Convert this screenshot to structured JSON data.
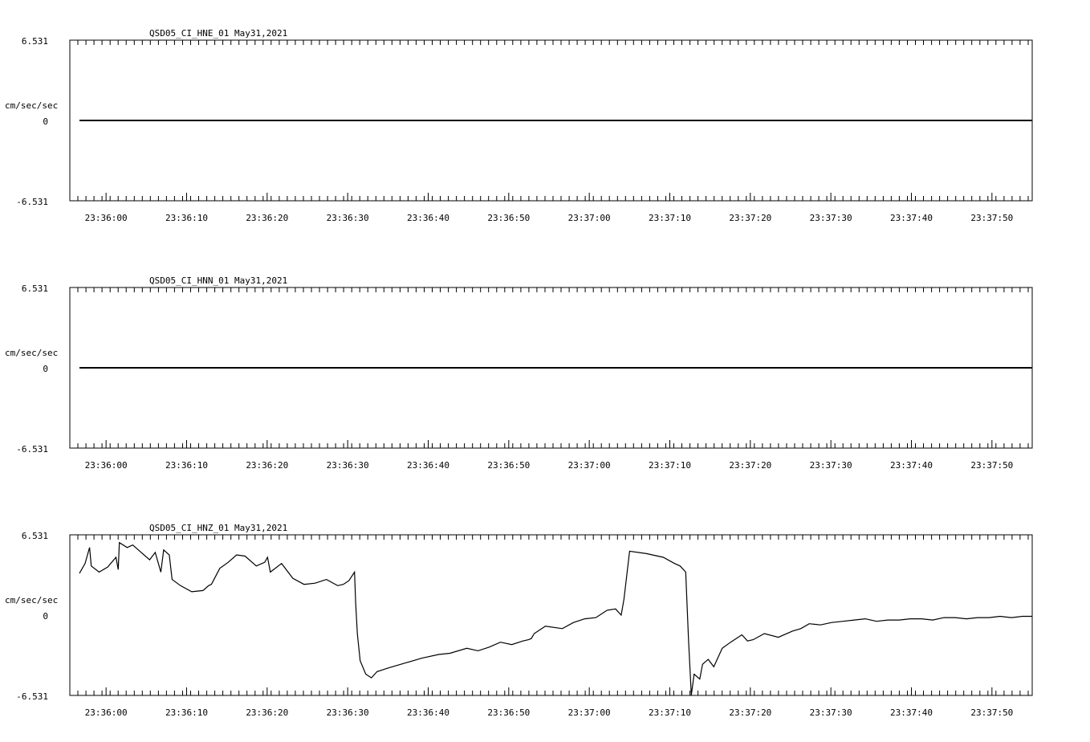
{
  "chart_data": [
    {
      "type": "line",
      "title": "QSD05_CI_HNE_01  May31,2021",
      "ylabel": "cm/sec/sec",
      "ylim": [
        -6.531,
        6.531
      ],
      "yticks": [
        "6.531",
        "0",
        "-6.531"
      ],
      "x_start": "23:35:55.5",
      "x_end": "23:37:55",
      "xticks": [
        "23:36:00",
        "23:36:10",
        "23:36:20",
        "23:36:30",
        "23:36:40",
        "23:36:50",
        "23:37:00",
        "23:37:10",
        "23:37:20",
        "23:37:30",
        "23:37:40",
        "23:37:50"
      ],
      "series": [
        {
          "points": [
            [
              0.0,
              0.0
            ],
            [
              118.5,
              0.0
            ]
          ]
        }
      ]
    },
    {
      "type": "line",
      "title": "QSD05_CI_HNN_01  May31,2021",
      "ylabel": "cm/sec/sec",
      "ylim": [
        -6.531,
        6.531
      ],
      "yticks": [
        "6.531",
        "0",
        "-6.531"
      ],
      "x_start": "23:35:55.5",
      "x_end": "23:37:55",
      "xticks": [
        "23:36:00",
        "23:36:10",
        "23:36:20",
        "23:36:30",
        "23:36:40",
        "23:36:50",
        "23:37:00",
        "23:37:10",
        "23:37:20",
        "23:37:30",
        "23:37:40",
        "23:37:50"
      ],
      "series": [
        {
          "points": [
            [
              0.0,
              0.0
            ],
            [
              118.5,
              0.0
            ]
          ]
        }
      ]
    },
    {
      "type": "line",
      "title": "QSD05_CI_HNZ_01  May31,2021",
      "ylabel": "cm/sec/sec",
      "ylim": [
        -6.531,
        6.531
      ],
      "yticks": [
        "6.531",
        "0",
        "-6.531"
      ],
      "x_start": "23:35:55.5",
      "x_end": "23:37:55",
      "xticks": [
        "23:36:00",
        "23:36:10",
        "23:36:20",
        "23:36:30",
        "23:36:40",
        "23:36:50",
        "23:37:00",
        "23:37:10",
        "23:37:20",
        "23:37:30",
        "23:37:40",
        "23:37:50"
      ],
      "series": [
        {
          "points": [
            [
              0.0,
              3.4
            ],
            [
              1.0,
              4.2
            ],
            [
              1.8,
              5.5
            ],
            [
              2.1,
              4.0
            ],
            [
              3.5,
              3.5
            ],
            [
              5.0,
              3.9
            ],
            [
              6.5,
              4.7
            ],
            [
              6.9,
              3.7
            ],
            [
              7.1,
              5.9
            ],
            [
              8.5,
              5.5
            ],
            [
              9.5,
              5.7
            ],
            [
              11.0,
              5.1
            ],
            [
              12.5,
              4.5
            ],
            [
              13.5,
              5.1
            ],
            [
              14.5,
              3.5
            ],
            [
              15.0,
              5.3
            ],
            [
              16.0,
              4.9
            ],
            [
              16.5,
              2.9
            ],
            [
              18.0,
              2.4
            ],
            [
              20.0,
              1.9
            ],
            [
              22.0,
              2.0
            ],
            [
              23.0,
              2.4
            ],
            [
              23.5,
              2.5
            ],
            [
              25.0,
              3.8
            ],
            [
              26.5,
              4.3
            ],
            [
              28.0,
              4.9
            ],
            [
              29.5,
              4.8
            ],
            [
              31.5,
              4.0
            ],
            [
              33.0,
              4.3
            ],
            [
              33.5,
              4.7
            ],
            [
              34.0,
              3.5
            ],
            [
              36.0,
              4.2
            ],
            [
              38.0,
              3.0
            ],
            [
              40.0,
              2.5
            ],
            [
              42.0,
              2.6
            ],
            [
              44.0,
              2.9
            ],
            [
              46.0,
              2.4
            ],
            [
              47.0,
              2.5
            ],
            [
              48.0,
              2.8
            ],
            [
              49.0,
              3.5
            ],
            [
              49.2,
              1.0
            ],
            [
              49.5,
              -1.5
            ],
            [
              50.0,
              -3.7
            ],
            [
              51.0,
              -4.8
            ],
            [
              52.0,
              -5.1
            ],
            [
              53.0,
              -4.6
            ],
            [
              55.0,
              -4.3
            ],
            [
              58.0,
              -3.9
            ],
            [
              61.0,
              -3.5
            ],
            [
              64.0,
              -3.2
            ],
            [
              66.0,
              -3.1
            ],
            [
              69.0,
              -2.7
            ],
            [
              71.0,
              -2.9
            ],
            [
              73.0,
              -2.6
            ],
            [
              75.0,
              -2.2
            ],
            [
              77.0,
              -2.4
            ],
            [
              79.0,
              -2.1
            ],
            [
              80.0,
              -2.0
            ],
            [
              80.5,
              -1.9
            ],
            [
              81.0,
              -1.5
            ],
            [
              83.0,
              -0.9
            ],
            [
              86.0,
              -1.1
            ],
            [
              88.0,
              -0.6
            ],
            [
              90.0,
              -0.3
            ],
            [
              92.0,
              -0.2
            ],
            [
              94.0,
              0.4
            ],
            [
              95.5,
              0.5
            ],
            [
              96.5,
              0.0
            ],
            [
              97.0,
              1.3
            ],
            [
              98.0,
              5.2
            ],
            [
              101.0,
              5.0
            ],
            [
              104.0,
              4.7
            ],
            [
              106.0,
              4.2
            ],
            [
              107.0,
              4.0
            ],
            [
              108.0,
              3.5
            ],
            [
              108.5,
              -2.0
            ],
            [
              109.0,
              -6.5
            ],
            [
              109.5,
              -4.8
            ],
            [
              110.5,
              -5.2
            ],
            [
              111.0,
              -4.0
            ],
            [
              112.0,
              -3.6
            ],
            [
              113.0,
              -4.2
            ],
            [
              114.5,
              -2.7
            ],
            [
              116.0,
              -2.2
            ],
            [
              118.0,
              -1.6
            ],
            [
              119.0,
              -2.1
            ],
            [
              120.0,
              -2.0
            ],
            [
              122.0,
              -1.5
            ],
            [
              124.5,
              -1.8
            ],
            [
              127.0,
              -1.3
            ],
            [
              128.5,
              -1.1
            ],
            [
              130.0,
              -0.7
            ],
            [
              132.0,
              -0.8
            ],
            [
              134.0,
              -0.6
            ],
            [
              136.0,
              -0.5
            ],
            [
              138.0,
              -0.4
            ],
            [
              140.0,
              -0.3
            ],
            [
              142.0,
              -0.5
            ],
            [
              144.0,
              -0.4
            ],
            [
              146.0,
              -0.4
            ],
            [
              148.0,
              -0.3
            ],
            [
              150.0,
              -0.3
            ],
            [
              152.0,
              -0.4
            ],
            [
              154.0,
              -0.2
            ],
            [
              156.0,
              -0.2
            ],
            [
              158.0,
              -0.3
            ],
            [
              160.0,
              -0.2
            ],
            [
              162.0,
              -0.2
            ],
            [
              164.0,
              -0.1
            ],
            [
              166.0,
              -0.2
            ],
            [
              168.0,
              -0.1
            ],
            [
              170.0,
              -0.1
            ],
            [
              118.5,
              -2.0
            ]
          ]
        }
      ]
    }
  ]
}
